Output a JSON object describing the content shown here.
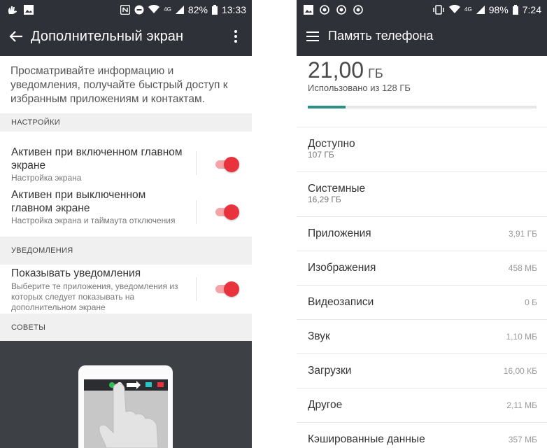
{
  "left": {
    "status": {
      "battery": "82%",
      "time": "13:33",
      "signal_badge": "4G"
    },
    "header": {
      "title": "Дополнительный экран"
    },
    "intro": "Просматривайте информацию и уведомления, получайте быстрый доступ к избранным приложениям и контактам.",
    "sections": {
      "settings": "НАСТРОЙКИ",
      "notifications": "УВЕДОМЛЕНИЯ",
      "tips": "СОВЕТЫ"
    },
    "items": [
      {
        "title": "Активен при включенном главном экране",
        "subtitle": "Настройка экрана",
        "enabled": true
      },
      {
        "title": "Активен при выключенном главном экране",
        "subtitle": "Настройка экрана и таймаута отключения",
        "enabled": true
      },
      {
        "title": "Показывать уведомления",
        "subtitle": "Выберите те приложения, уведомления из которых следует показывать на дополнительном экране",
        "enabled": true
      }
    ]
  },
  "right": {
    "status": {
      "battery": "98%",
      "time": "7:24",
      "signal_badge": "4G"
    },
    "header": {
      "title": "Память телефона"
    },
    "summary": {
      "used_value": "21,00",
      "used_unit": "ГБ",
      "used_of": "Использовано из 128 ГБ",
      "fraction": 0.164
    },
    "available": {
      "title": "Доступно",
      "value": "107 ГБ"
    },
    "system": {
      "title": "Системные",
      "value": "16,29 ГБ"
    },
    "categories": [
      {
        "name": "Приложения",
        "size": "3,91 ГБ"
      },
      {
        "name": "Изображения",
        "size": "458 МБ"
      },
      {
        "name": "Видеозаписи",
        "size": "0 Б"
      },
      {
        "name": "Звук",
        "size": "1,10 МБ"
      },
      {
        "name": "Загрузки",
        "size": "16,00 КБ"
      },
      {
        "name": "Другое",
        "size": "2,11 МБ"
      },
      {
        "name": "Кэшированные данные",
        "size": "357 МБ"
      }
    ],
    "accent": "#2e8f86"
  },
  "colors": {
    "toolbar": "#2e3138",
    "toggle_on": "#e8333e"
  }
}
